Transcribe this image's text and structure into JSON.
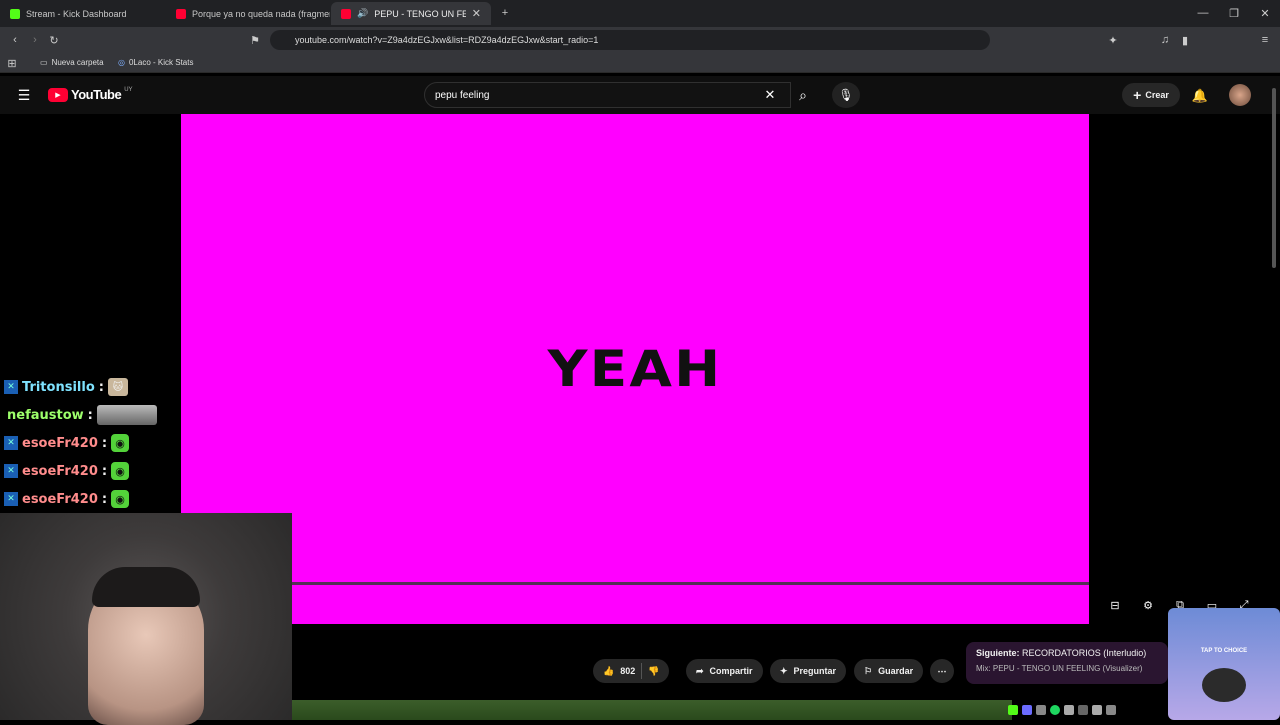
{
  "tabs": [
    {
      "title": "Stream - Kick Dashboard",
      "color": "#53fc18"
    },
    {
      "title": "Porque ya no queda nada (fragment",
      "color": "#ff0033"
    },
    {
      "title": "PEPU - TENGO UN FEELING (\\",
      "color": "#ff0033"
    }
  ],
  "browser": {
    "url": "youtube.com/watch?v=Z9a4dzEGJxw&list=RDZ9a4dzEGJxw&start_radio=1",
    "bookmarks": [
      "Nueva carpeta",
      "0Laco - Kick Stats"
    ]
  },
  "youtube": {
    "logo": "YouTube",
    "region": "UY",
    "search": "pepu feeling",
    "create_label": "Crear"
  },
  "video": {
    "text": "YEAH",
    "color": "#ff00ff"
  },
  "chat": [
    {
      "user": "Tritonsillo",
      "color": "#7fe3ff",
      "badge": true,
      "emote": "cat"
    },
    {
      "user": "nefaustow",
      "color": "#9dff6b",
      "badge": false,
      "emote": "dog"
    },
    {
      "user": "esoeFr420",
      "color": "#ff8c8c",
      "badge": true,
      "emote": "kick"
    },
    {
      "user": "esoeFr420",
      "color": "#ff8c8c",
      "badge": true,
      "emote": "kick"
    },
    {
      "user": "esoeFr420",
      "color": "#ff8c8c",
      "badge": true,
      "emote": "kick"
    }
  ],
  "actions": {
    "likes": "802",
    "share": "Compartir",
    "ask": "Preguntar",
    "save": "Guardar"
  },
  "next": {
    "label": "Siguiente:",
    "title": "RECORDATORIOS (Interludio)",
    "mix": "Mix: PEPU - TENGO UN FEELING (Visualizer)"
  },
  "overlay": {
    "text": "TAP TO CHOICE"
  }
}
